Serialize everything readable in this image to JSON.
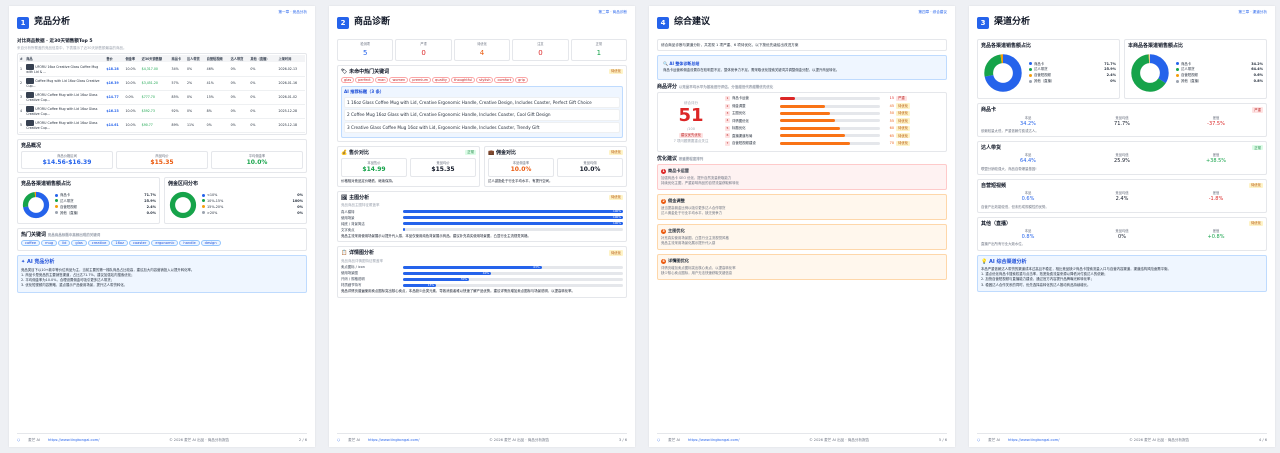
{
  "footer": {
    "brand": "麦芒 AI",
    "url": "https://www.tingkongai.com/",
    "copyright": "© 2026 麦芒 AI 出品 · 商品分析报告"
  },
  "page1": {
    "chapter": "第一章 · 竞品分析",
    "num": "1",
    "title": "竞品分析",
    "top5_title": "对比商品数据 · 近30天销售额Top 5",
    "top5_sub": "来自分析所覆盖的竞品信息中，下表展示了近30天销售额最高的商品。",
    "table_headers": [
      "#",
      "商品",
      "售价",
      "佣金率",
      "近30天销售额",
      "商品卡",
      "达人带货",
      "自营短视频",
      "达人带货",
      "其他（直播）",
      "上架时间"
    ],
    "rows": [
      {
        "rank": "1",
        "name": "UFORU 16oz Creative Glass Coffee Mug with Lid & ...",
        "price": "$18.28",
        "comm": "10.0%",
        "sales": "$4,317.00",
        "a": "34%",
        "b": "0%",
        "c": "46%",
        "d": "0%",
        "date": "2026-02-13"
      },
      {
        "rank": "2",
        "name": "Coffee Mug with Lid 16oz Glass Creative Cup...",
        "price": "$16.39",
        "comm": "10.0%",
        "sales": "$3,451.20",
        "a": "57%",
        "b": "2%",
        "c": "41%",
        "d": "0%",
        "date": "2026-01-16"
      },
      {
        "rank": "3",
        "name": "UFORU Coffee Mug with Lid 16oz Glass Creative Cup...",
        "price": "$14.77",
        "comm": "0.0%",
        "sales": "$777.70",
        "a": "85%",
        "b": "0%",
        "c": "15%",
        "d": "0%",
        "date": "2026-01-02"
      },
      {
        "rank": "4",
        "name": "UFORU Coffee Mug with Lid 16oz Glass Creative Cup...",
        "price": "$16.23",
        "comm": "10.0%",
        "sales": "$592.73",
        "a": "92%",
        "b": "0%",
        "c": "8%",
        "d": "0%",
        "date": "2025-12-28"
      },
      {
        "rank": "5",
        "name": "UFORU Coffee Mug with Lid 16oz Glass Creative Cup...",
        "price": "$14.61",
        "comm": "10.0%",
        "sales": "$90.77",
        "a": "89%",
        "b": "11%",
        "c": "0%",
        "d": "0%",
        "date": "2025-12-18"
      }
    ],
    "overview_title": "竞品概况",
    "overview": [
      {
        "label": "商品价格区间",
        "value": "$14.56-$16.39",
        "color": "#2563eb"
      },
      {
        "label": "商品均价",
        "value": "$15.35",
        "color": "#ea580c"
      },
      {
        "label": "平均佣金率",
        "value": "10.0%",
        "color": "#16a34a"
      }
    ],
    "channel_title": "竞品各渠道销售额占比",
    "channel_legend": [
      {
        "name": "商品卡",
        "value": "71.7%",
        "color": "#2563eb"
      },
      {
        "name": "达人带货",
        "value": "25.9%",
        "color": "#16a34a"
      },
      {
        "name": "自营短视频",
        "value": "2.4%",
        "color": "#f59e0b"
      },
      {
        "name": "其他（直播）",
        "value": "0.0%",
        "color": "#9ca3af"
      }
    ],
    "commission_title": "佣金区间分布",
    "commission_legend": [
      {
        "name": "<10%",
        "value": "0%",
        "color": "#2563eb"
      },
      {
        "name": "10%-15%",
        "value": "100%",
        "color": "#16a34a"
      },
      {
        "name": "15%-20%",
        "value": "0%",
        "color": "#f59e0b"
      },
      {
        "name": ">20%",
        "value": "0%",
        "color": "#9ca3af"
      }
    ],
    "kw_title": "热门关键词",
    "kw_sub": "竞品商品标题中高频出现的关键词",
    "keywords": [
      "coffee",
      "mug",
      "lid",
      "glas",
      "creative",
      "16oz",
      "coaster",
      "ergonomic",
      "handle",
      "design"
    ],
    "ai_title": "AI 竞品分析",
    "ai_lines": [
      "竞品类目下以10+款中等价位商品为主，当前主要的第一梯队商品占比较高，建议加大内容营销投入以提升转化率。",
      "1. 商品卡是竞品的主要销售渠道，占比达71.7%，建议加强站内搜索优化；",
      "2. 平均佣金率为10.0%，合理设置佣金可吸引更多达人带货；",
      "3. 优化短视频内容策略，重点展示产品使用场景，提升达人带货转化。"
    ]
  },
  "page2": {
    "chapter": "第二章 · 商品诊断",
    "num": "2",
    "title": "商品诊断",
    "scores": [
      {
        "label": "检测项",
        "value": "5",
        "color": "#2563eb"
      },
      {
        "label": "严重",
        "value": "0",
        "color": "#dc2626"
      },
      {
        "label": "待优化",
        "value": "4",
        "color": "#ea580c"
      },
      {
        "label": "注意",
        "value": "0",
        "color": "#dc2626"
      },
      {
        "label": "正常",
        "value": "1",
        "color": "#16a34a"
      }
    ],
    "kw_title": "未命中热门关键词",
    "kw_badge": "待优化",
    "missing_keywords": [
      "glas",
      "perfect",
      "man",
      "women",
      "premium",
      "quality",
      "thoughtful",
      "stylish",
      "comfort",
      "grip"
    ],
    "rec_title": "AI 推荐标题（3 条）",
    "rec_titles": [
      "16oz Glass Coffee Mug with Lid, Creative Ergonomic Handle, Creative Design, Includes Coaster, Perfect Gift Choice",
      "Coffee Mug 16oz Glass with Lid, Creative Ergonomic Handle, Includes Coaster, Cool Gift Design",
      "Creative Glass Coffee Mug 16oz with Lid, Ergonomic Handle, Includes Coaster, Trendy Gift"
    ],
    "price_title": "售价对比",
    "price_badge": "正常",
    "price_items": [
      {
        "label": "本品售价",
        "value": "$14.99"
      },
      {
        "label": "竞品均价",
        "value": "$15.35"
      }
    ],
    "price_note": "价格相对竞品定价略低，继续保持。",
    "comm_title": "佣金对比",
    "comm_badge": "待优化",
    "comm_items": [
      {
        "label": "本品佣金率",
        "value": "10.0%"
      },
      {
        "label": "竞品均佣",
        "value": "10.0%"
      }
    ],
    "comm_note": "达人激励处于行业平均水平，有提升空间。",
    "main_title": "主图分析",
    "main_badge": "待优化",
    "main_sub": "竞品商品主图特征覆盖率",
    "main_bars": [
      {
        "label": "真人模特",
        "value": 100
      },
      {
        "label": "使用场景",
        "value": 100
      },
      {
        "label": "纯底 / 背景简洁",
        "value": 100
      },
      {
        "label": "文字卖点",
        "value": 0
      }
    ],
    "main_note": "竞品主流采用使用场景展示以提升代入感，本品仅使用纯色背景展示商品。建议补充真实使用场景图，凸显行业主流视觉风格。",
    "detail_title": "详情图分析",
    "detail_badge": "待优化",
    "detail_sub": "竞品商品详情图特征覆盖率",
    "detail_bars": [
      {
        "label": "卖点图标 / icon",
        "value": 63
      },
      {
        "label": "使用场景图",
        "value": 40
      },
      {
        "label": "尺码 / 规格说明",
        "value": 30
      },
      {
        "label": "材质细节特写",
        "value": 15
      }
    ],
    "detail_note": "竞品详情页普遍使用卖点图标突出核心卖点，本品缺少此类元素，导致消费者难以快速了解产品优势。建议详情页增加卖点图标与场景说明，以提高转化率。"
  },
  "page3": {
    "chapter": "第四章 · 综合建议",
    "num": "4",
    "title": "综合建议",
    "intro": "综合商品诊断与渠道分析，共发现 1 项严重、6 项待优化，以下按优先级给出改进方案",
    "ai_title": "AI 整体诊断总结",
    "ai_text": "商品卡运营和佣金设置存在较明显不足，整体竞争力不足。需采取优化搜索关键词并调整佣金分配，以提升商品转化。",
    "eval_title": "商品评分",
    "eval_sub": "以竞品平均水平为基准进行评估，分值越低代表越需优先优化",
    "total_label": "综合评分",
    "total_score": "51",
    "total_max": "/100",
    "total_badge": "建议优先优化",
    "total_note": "7 项问题需要重点关注",
    "items": [
      {
        "rank": "1",
        "name": "商品卡运营",
        "score": 15,
        "badge": "严重"
      },
      {
        "rank": "2",
        "name": "佣金调整",
        "score": 45,
        "badge": "待优化"
      },
      {
        "rank": "3",
        "name": "主图优化",
        "score": 50,
        "badge": "待优化"
      },
      {
        "rank": "4",
        "name": "详情图优化",
        "score": 55,
        "badge": "待优化"
      },
      {
        "rank": "5",
        "name": "标题优化",
        "score": 60,
        "badge": "待优化"
      },
      {
        "rank": "6",
        "name": "直播渠道布局",
        "score": 65,
        "badge": "待优化"
      },
      {
        "rank": "7",
        "name": "自营短视频建设",
        "score": 70,
        "badge": "待优化"
      }
    ],
    "opt_title": "优化建议",
    "opt_sub": "按重要程度排列",
    "suggestions": [
      {
        "num": "1",
        "title": "商品卡运营",
        "lines": [
          "加强商品卡 SEO 优化，提升自然流量获取能力",
          "持续优化主图，严重影响商品的自然流量获取和转化"
        ],
        "kind": "red"
      },
      {
        "num": "2",
        "title": "佣金调整",
        "lines": [
          "适当提高佣金比例以吸引更多达人合作带货",
          "达人佣金处于行业平均水平，缺乏竞争力"
        ],
        "kind": "or"
      },
      {
        "num": "3",
        "title": "主图优化",
        "lines": [
          "补充真实使用场景图，凸显行业主流视觉风格",
          "竞品主流采用场景化展示提升代入感"
        ],
        "kind": "or"
      },
      {
        "num": "4",
        "title": "详情图优化",
        "lines": [
          "详情页增加卖点图标突出核心卖点，以提高转化率",
          "缺少核心卖点图标，用户无法快速获取关键信息"
        ],
        "kind": "or"
      }
    ]
  },
  "page4": {
    "chapter": "第三章 · 渠道分析",
    "num": "3",
    "title": "渠道分析",
    "comp_title": "竞品各渠道销售额占比",
    "comp_legend": [
      {
        "name": "商品卡",
        "value": "71.7%",
        "color": "#2563eb"
      },
      {
        "name": "达人带货",
        "value": "25.9%",
        "color": "#16a34a"
      },
      {
        "name": "自营短视频",
        "value": "2.4%",
        "color": "#f59e0b"
      },
      {
        "name": "其他（直播）",
        "value": "0%",
        "color": "#9ca3af"
      }
    ],
    "self_title": "本商品各渠道销售额占比",
    "self_legend": [
      {
        "name": "商品卡",
        "value": "34.2%",
        "color": "#2563eb"
      },
      {
        "name": "达人带货",
        "value": "64.4%",
        "color": "#16a34a"
      },
      {
        "name": "自营短视频",
        "value": "0.6%",
        "color": "#f59e0b"
      },
      {
        "name": "其他（直播）",
        "value": "0.8%",
        "color": "#9ca3af"
      }
    ],
    "labels": {
      "self": "本品",
      "comp": "竞品均值",
      "diff": "差值"
    },
    "channels": [
      {
        "title": "商品卡",
        "badge": "严重",
        "kind": "red",
        "self": "34.2%",
        "comp": "71.7%",
        "diff": "-37.5%",
        "note": "依赖较量太低，严重依赖付费或达人。"
      },
      {
        "title": "达人带货",
        "badge": "正常",
        "kind": "green",
        "self": "64.4%",
        "comp": "25.9%",
        "diff": "+38.5%",
        "note": "联盟分销较强大，商品自带爆量基因!"
      },
      {
        "title": "自营短视频",
        "badge": "待优化",
        "kind": "or",
        "self": "0.6%",
        "comp": "2.4%",
        "diff": "-1.8%",
        "note": "自营产出效能较低，但未形成规模性的优势。"
      },
      {
        "title": "其他（直播）",
        "badge": "待优化",
        "kind": "or",
        "self": "0.8%",
        "comp": "0%",
        "diff": "+0.8%",
        "note": "直播产出所有行业大致水位。"
      }
    ],
    "ai_title": "AI 综合渠道分析",
    "ai_lines": [
      "本品严重依赖达人带货的渠道成本过高且不稳定，相比竞品缺少商品卡搜索流量入口与自营内容渠道，渠道结构风险亟需平衡。",
      "1. 重点优化商品卡搜索权重与点击率，拓宽免费流量来源以降低对付费达人的依赖；",
      "2. 加快自营短视频与直播能力建设，通过官方内容提升品牌曝光和转化率；",
      "3. 稳固达人合作关系的同时，优先选择高转化的达人推动商品持续增长。"
    ]
  }
}
